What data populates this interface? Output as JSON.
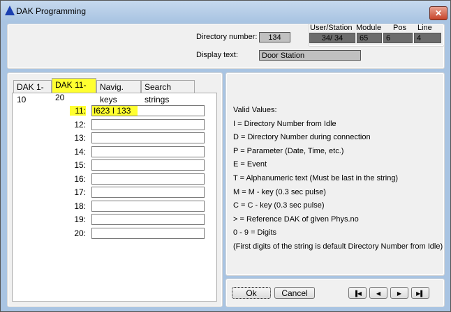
{
  "window": {
    "title": "DAK Programming",
    "close": "✕"
  },
  "header": {
    "directory_label": "Directory number:",
    "directory_value": "134",
    "display_label": "Display text:",
    "display_value": "Door Station",
    "user_station_label": "User/Station",
    "user_station_value": "34/   34",
    "module_label": "Module",
    "module_value": "65",
    "pos_label": "Pos",
    "pos_value": "6",
    "line_label": "Line",
    "line_value": "4"
  },
  "tabs": [
    {
      "label": "DAK 1-10"
    },
    {
      "label": "DAK 11-20"
    },
    {
      "label": "Navig. keys"
    },
    {
      "label": "Search strings"
    }
  ],
  "rows": [
    {
      "label": "11:",
      "value": "I623 I 133"
    },
    {
      "label": "12:",
      "value": ""
    },
    {
      "label": "13:",
      "value": ""
    },
    {
      "label": "14:",
      "value": ""
    },
    {
      "label": "15:",
      "value": ""
    },
    {
      "label": "16:",
      "value": ""
    },
    {
      "label": "17:",
      "value": ""
    },
    {
      "label": "18:",
      "value": ""
    },
    {
      "label": "19:",
      "value": ""
    },
    {
      "label": "20:",
      "value": ""
    }
  ],
  "help": [
    "Valid Values:",
    "I = Directory Number from Idle",
    "D = Directory Number during connection",
    "P = Parameter (Date, Time, etc.)",
    "E = Event",
    "T = Alphanumeric text (Must be last in the string)",
    "M = M - key (0.3 sec pulse)",
    "C = C - key (0.3 sec pulse)",
    "> = Reference DAK of given Phys.no",
    "0 - 9 = Digits",
    "(First digits of the string is default Directory Number from Idle)"
  ],
  "buttons": {
    "ok": "Ok",
    "cancel": "Cancel",
    "first": "▐◀",
    "prev": "◀",
    "next": "▶",
    "last": "▶▌"
  }
}
